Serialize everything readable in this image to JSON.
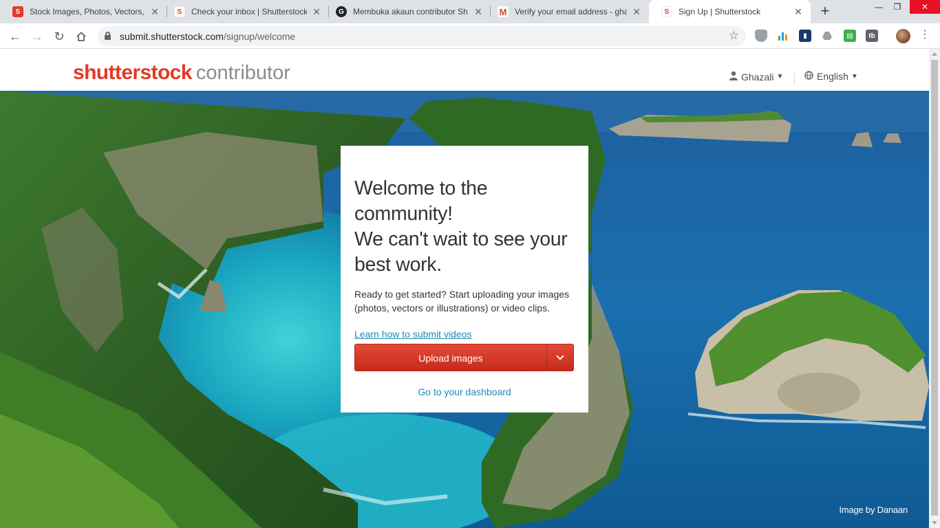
{
  "browser": {
    "tabs": [
      {
        "title": "Stock Images, Photos, Vectors, V",
        "favicon": "shutterstock-favicon"
      },
      {
        "title": "Check your inbox | Shutterstock",
        "favicon": "shutterstock-favicon"
      },
      {
        "title": "Membuka akaun contributor Sh",
        "favicon": "blog-favicon"
      },
      {
        "title": "Verify your email address - ghaz",
        "favicon": "gmail-favicon"
      },
      {
        "title": "Sign Up | Shutterstock",
        "favicon": "shutterstock-favicon",
        "active": true
      }
    ],
    "new_tab_glyph": "+",
    "url_host": "submit.shutterstock.com",
    "url_path": "/signup/welcome",
    "colors": {
      "tabstrip": "#dee1e6",
      "omnibox": "#f1f3f4"
    }
  },
  "site": {
    "logo_brand": "shutterstock",
    "logo_sub": "contributor",
    "user_name": "Ghazali",
    "language": "English",
    "brand_color": "#e33a26",
    "link_color": "#1e88b8"
  },
  "card": {
    "title_line1": "Welcome to the community!",
    "title_line2": "We can't wait to see your best work.",
    "lead": "Ready to get started? Start uploading your images (photos, vectors or illustrations) or video clips.",
    "learn_link": "Learn how to submit videos",
    "upload_button": "Upload images",
    "dashboard_link": "Go to your dashboard"
  },
  "hero": {
    "credit": "Image by Danaan"
  }
}
